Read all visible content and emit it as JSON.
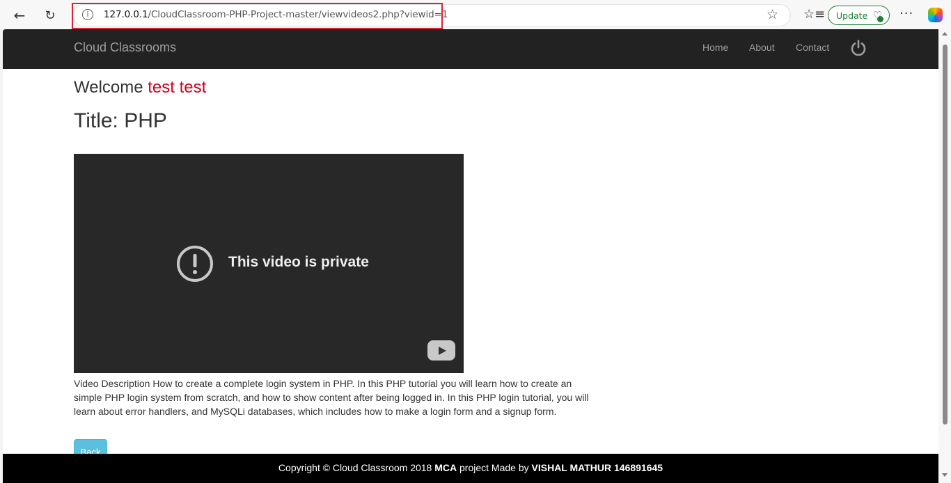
{
  "browser": {
    "url_host": "127.0.0.1",
    "url_path": "/CloudClassroom-PHP-Project-master/viewvideos2.php?viewid=1",
    "update_label": "Update"
  },
  "navbar": {
    "brand": "Cloud Classrooms",
    "links": [
      "Home",
      "About",
      "Contact"
    ]
  },
  "page": {
    "welcome_prefix": "Welcome",
    "welcome_user": "test test",
    "title": "Title: PHP",
    "video_message": "This video is private",
    "description": "Video Description How to create a complete login system in PHP. In this PHP tutorial you will learn how to create an simple PHP login system from scratch, and how to show content after being logged in. In this PHP login tutorial, you will learn about error handlers, and MySQLi databases, which includes how to make a login form and a signup form.",
    "back_label": "Back"
  },
  "footer": {
    "text_1": "Copyright © Cloud Classroom 2018 ",
    "bold_1": "MCA",
    "text_2": " project Made by ",
    "bold_2": "VISHAL MATHUR 146891645"
  },
  "colors": {
    "navbar_bg": "#222222",
    "welcome_user": "#d0021b",
    "back_button": "#5bc0de",
    "address_highlight": "#d9232f"
  },
  "icons": [
    "back-arrow-icon",
    "reload-icon",
    "info-icon",
    "star-icon",
    "favorites-icon",
    "heart-icon",
    "more-icon",
    "copilot-icon",
    "power-icon",
    "exclamation-circle-icon",
    "youtube-logo-icon"
  ]
}
